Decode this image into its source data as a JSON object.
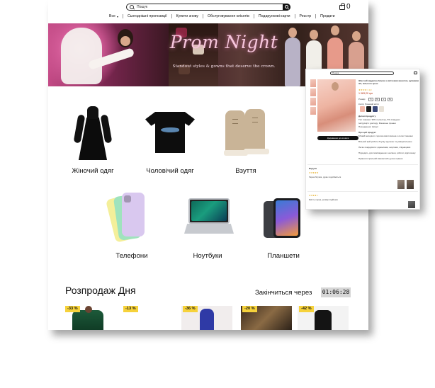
{
  "main": {
    "search": {
      "placeholder": "Пошук"
    },
    "cart": {
      "count": "0"
    },
    "nav": [
      {
        "label": "Все"
      },
      {
        "label": "Сьогоднішні пропозиції"
      },
      {
        "label": "Купити знову"
      },
      {
        "label": "Обслуговування клієнтів"
      },
      {
        "label": "Подарункові карти"
      },
      {
        "label": "Реєстр"
      },
      {
        "label": "Продати"
      }
    ],
    "hero": {
      "title": "Prom Night",
      "subtitle": "Standout styles & gowns that deserve the crown."
    },
    "categories": [
      {
        "label": "Жіночий одяг",
        "icon": "dress-icon"
      },
      {
        "label": "Чоловічий одяг",
        "icon": "tshirt-icon"
      },
      {
        "label": "Взуття",
        "icon": "boots-icon"
      },
      {
        "label": "Телефони",
        "icon": "phones-icon"
      },
      {
        "label": "Ноутбуки",
        "icon": "laptop-icon"
      },
      {
        "label": "Планшети",
        "icon": "tablet-icon"
      }
    ],
    "sale": {
      "title": "Розпродаж Дня",
      "ends_label": "Закінчиться через",
      "timer": "01:06:28",
      "badges": [
        "-33 %",
        "-13 %",
        "-36 %",
        "-20 %",
        "-42 %"
      ]
    }
  },
  "product_window": {
    "search_placeholder": "Пошук",
    "title": "Жіночий кардиган-блузка з квітковим принтом, рукавами 3/4, вільного крою",
    "price": "1 063,20 грн",
    "rating": "★★★★☆ 4,3",
    "size_label": "Розмір:",
    "sizes": [
      "S",
      "M",
      "L",
      "XL"
    ],
    "color_label": "Колір: Рожевий квіти",
    "add_to_cart": "Додавання до кошика",
    "details_title": "Деталі продукту",
    "details": [
      "Тип тканини: 95% поліестер, 5% спандекс",
      "Інструкції з догляду: Машинне прання",
      "Походження: Імпорт"
    ],
    "about_title": "Про цей продукт",
    "about": [
      "М'який матеріал: сорочка виготовлена з легкої тканини",
      "Вільний крій робить блузку зручною та універсальною",
      "Легко поєднувати з джинсами, шортами, спідницями",
      "Підходить для повсякденного носіння, роботи, відпочинку",
      "Прання в пральній машині або ручне прання"
    ],
    "reviews_title": "Відгуки",
    "reviews": [
      {
        "stars": "★★★★★",
        "text": "Гарна блузка, дуже подобається"
      },
      {
        "stars": "★★★★☆",
        "text": "Якість гарна, розмір підійшов"
      }
    ]
  }
}
